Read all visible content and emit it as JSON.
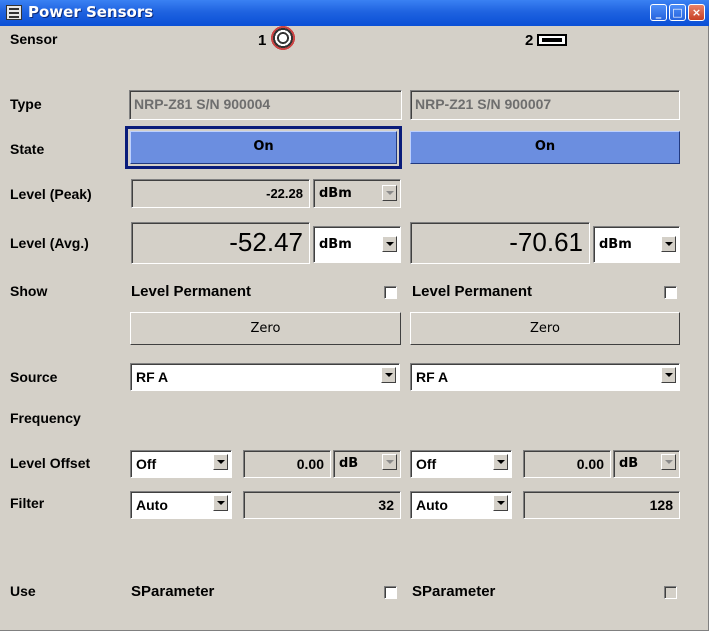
{
  "window": {
    "title": "Power Sensors"
  },
  "labels": {
    "sensor": "Sensor",
    "type": "Type",
    "state": "State",
    "level_peak": "Level (Peak)",
    "level_avg": "Level (Avg.)",
    "show": "Show",
    "source": "Source",
    "frequency": "Frequency",
    "level_offset": "Level Offset",
    "filter": "Filter",
    "use": "Use"
  },
  "sensors": [
    {
      "number": "1",
      "connector_icon": "round-connector-icon",
      "type": "NRP-Z81 S/N 900004",
      "state": "On",
      "level_peak": "-22.28",
      "level_peak_unit": "dBm",
      "level_avg": "-52.47",
      "level_avg_unit": "dBm",
      "show_label": "Level Permanent",
      "show_checked": false,
      "zero": "Zero",
      "source": "RF A",
      "offset_mode": "Off",
      "offset_value": "0.00",
      "offset_unit": "dB",
      "filter_mode": "Auto",
      "filter_value": "32",
      "use_label": "SParameter",
      "use_checked": false
    },
    {
      "number": "2",
      "connector_icon": "usb-connector-icon",
      "type": "NRP-Z21 S/N 900007",
      "state": "On",
      "level_avg": "-70.61",
      "level_avg_unit": "dBm",
      "show_label": "Level Permanent",
      "show_checked": false,
      "zero": "Zero",
      "source": "RF A",
      "offset_mode": "Off",
      "offset_value": "0.00",
      "offset_unit": "dB",
      "filter_mode": "Auto",
      "filter_value": "128",
      "use_label": "SParameter",
      "use_checked": false
    }
  ],
  "colors": {
    "title_bar": "#1f63e0",
    "state_on": "#6b8ee0",
    "window_bg": "#d4d0c8"
  }
}
